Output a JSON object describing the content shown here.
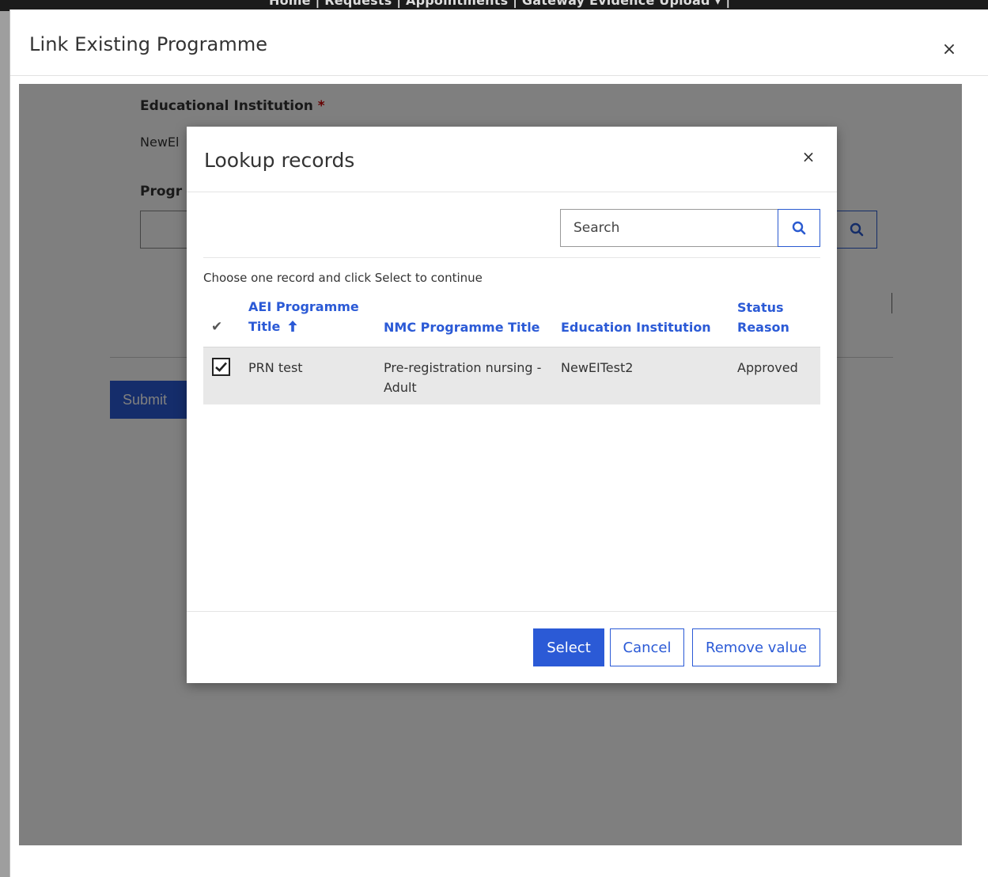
{
  "background_nav": {
    "text": "Home   |   Requests   |   Appointments   |   Gateway Evidence Upload ▾   |"
  },
  "outer_dialog": {
    "title": "Link Existing Programme",
    "close_glyph": "×",
    "form": {
      "institution_label": "Educational Institution",
      "required_marker": "*",
      "institution_value": "NewEl",
      "programme_label": "Progr",
      "submit_label": "Submit"
    }
  },
  "lookup": {
    "title": "Lookup records",
    "close_glyph": "×",
    "search": {
      "placeholder": "Search",
      "icon": "search-icon"
    },
    "instruction": "Choose one record and click Select to continue",
    "columns": {
      "aei": "AEI Programme Title",
      "nmc": "NMC Programme Title",
      "edu": "Education Institution",
      "status": "Status Reason"
    },
    "sort": {
      "column": "AEI Programme Title",
      "direction": "ascending"
    },
    "rows": [
      {
        "selected": true,
        "aei": "PRN test",
        "nmc": "Pre-registration nursing - Adult",
        "edu": "NewEITest2",
        "status": "Approved"
      }
    ],
    "buttons": {
      "select": "Select",
      "cancel": "Cancel",
      "remove": "Remove value"
    }
  },
  "colors": {
    "accent": "#2b5ad6",
    "required": "#cc0000",
    "selected_row": "#e8e8e8"
  }
}
